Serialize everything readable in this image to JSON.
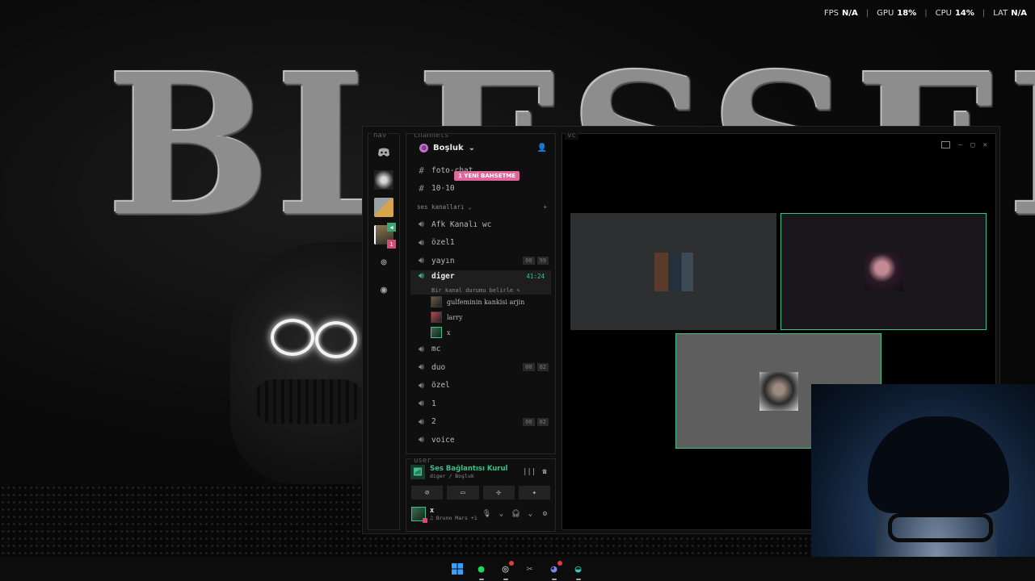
{
  "overlay": {
    "fps_label": "FPS",
    "fps_value": "N/A",
    "gpu_label": "GPU",
    "gpu_value": "18%",
    "cpu_label": "CPU",
    "cpu_value": "14%",
    "lat_label": "LAT",
    "lat_value": "N/A"
  },
  "wallpaper": {
    "title": "BLESSED"
  },
  "window": {
    "nav_label": "nav",
    "channels_label": "channels",
    "vc_label": "vc",
    "user_label": "user"
  },
  "server": {
    "name": "Boşluk",
    "new_messages": "1 YENİ BAHSETME"
  },
  "text_channels": [
    "foto-chat",
    "10-10"
  ],
  "voice_category": "ses kanalları",
  "voice_channels": [
    {
      "name": "Afk Kanalı wc",
      "count": ""
    },
    {
      "name": "özel1",
      "count": ""
    },
    {
      "name": "yayın",
      "count": "00",
      "limit": "99"
    }
  ],
  "active_channel": {
    "name": "diger",
    "timer": "41:24",
    "status": "Bir kanal durumu belirle",
    "users": [
      "gulfeminin kankisi arjin",
      "larry",
      "x"
    ]
  },
  "more_voice_channels": [
    {
      "name": "mc",
      "count": "",
      "limit": ""
    },
    {
      "name": "duo",
      "count": "00",
      "limit": "02"
    },
    {
      "name": "özel",
      "count": "",
      "limit": ""
    },
    {
      "name": "1",
      "count": "",
      "limit": ""
    },
    {
      "name": "2",
      "count": "00",
      "limit": "02"
    },
    {
      "name": "voice",
      "count": "",
      "limit": ""
    }
  ],
  "connection": {
    "title": "Ses Bağlantısı Kurul",
    "subtitle": "diger / Boşluk"
  },
  "me": {
    "name": "x",
    "activity": "♫ Bruno Mars +1"
  },
  "colors": {
    "accent": "#3ec08c",
    "badge": "#e0679a"
  }
}
